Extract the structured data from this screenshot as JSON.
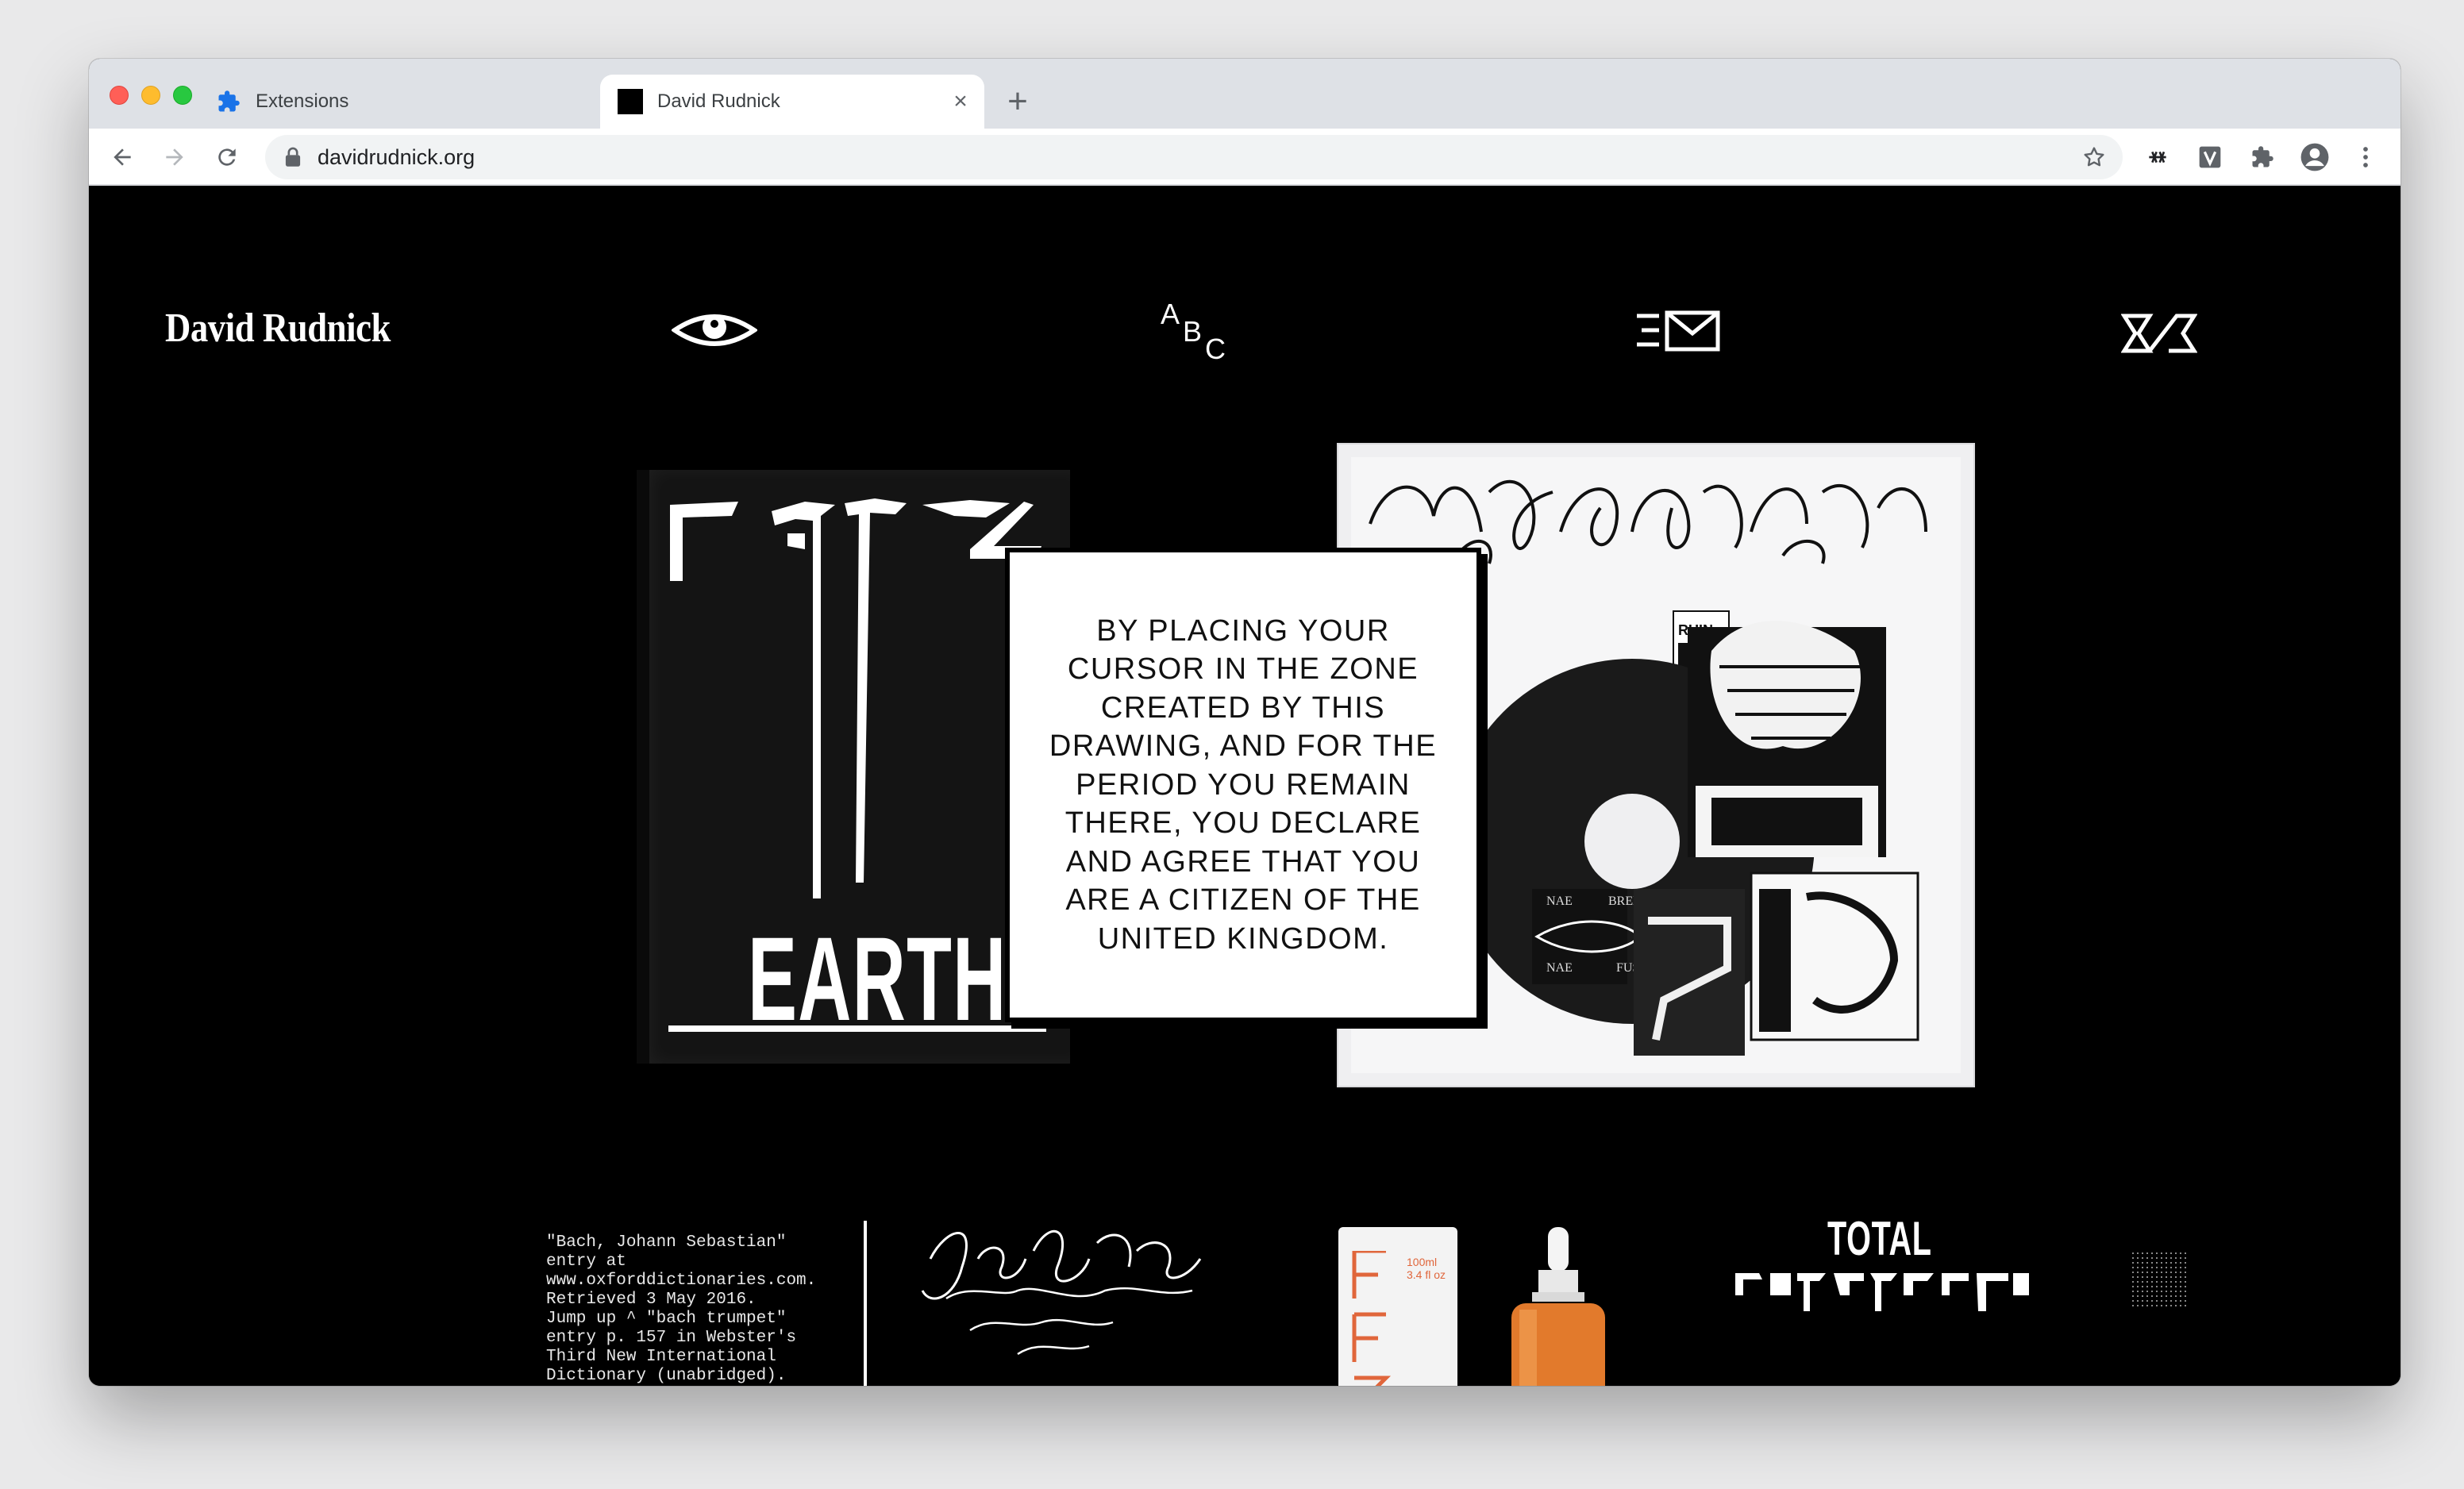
{
  "browser": {
    "tabs": [
      {
        "label": "Extensions",
        "icon": "puzzle-icon",
        "active": false
      },
      {
        "label": "David Rudnick",
        "icon": "black-square-favicon",
        "active": true
      }
    ],
    "url": "davidrudnick.org",
    "colors": {
      "tabstrip": "#dee1e6",
      "toolbar": "#ffffff",
      "accent_blue": "#1a73e8"
    }
  },
  "site": {
    "title": "David Rudnick",
    "nav": [
      {
        "name": "eye-icon"
      },
      {
        "name": "abc-icon",
        "letters": [
          "A",
          "B",
          "C"
        ]
      },
      {
        "name": "mail-icon"
      },
      {
        "name": "rudnick-logo-icon"
      }
    ],
    "book": {
      "title": "EARTH"
    },
    "notice": "BY PLACING YOUR CURSOR IN THE ZONE CREATED BY THIS DRAWING, AND FOR THE PERIOD YOU REMAIN THERE, YOU DECLARE AND AGREE THAT YOU ARE A CITIZEN OF THE UNITED KINGDOM.",
    "vinyl_labels": {
      "nae_1": "NAE",
      "breks": "BREKS",
      "nae_2": "NAE",
      "fuss": "FUSS",
      "ruin": "RUIN"
    },
    "citation": "\"Bach, Johann Sebastian\"\nentry at\nwww.oxforddictionaries.com.\nRetrieved 3 May 2016.\nJump up ^ \"bach trumpet\"\nentry p. 157 in Webster's\nThird New International\nDictionary (unabridged).",
    "product": {
      "volume": "100ml\n3.4 fl oz"
    },
    "total": "TOTAL"
  }
}
